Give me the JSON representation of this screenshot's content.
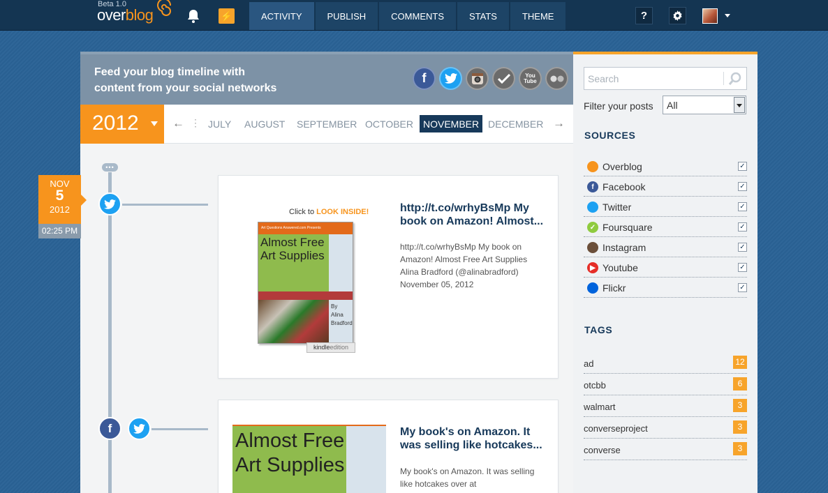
{
  "header": {
    "logo_beta": "Beta 1.0",
    "logo_over": "over",
    "logo_blog": "blog",
    "tabs": [
      {
        "label": "ACTIVITY"
      },
      {
        "label": "PUBLISH"
      },
      {
        "label": "COMMENTS"
      },
      {
        "label": "STATS"
      },
      {
        "label": "THEME"
      }
    ],
    "active_tab": "ACTIVITY",
    "help_label": "?"
  },
  "banner": {
    "line1": "Feed your blog timeline with",
    "line2": "content from your social networks",
    "social_icons": [
      "facebook-icon",
      "twitter-icon",
      "instagram-icon",
      "foursquare-icon",
      "youtube-icon",
      "flickr-icon"
    ],
    "youtube_label": "You Tube"
  },
  "timeline": {
    "year": "2012",
    "months": [
      {
        "label": "JULY"
      },
      {
        "label": "AUGUST"
      },
      {
        "label": "SEPTEMBER"
      },
      {
        "label": "OCTOBER"
      },
      {
        "label": "NOVEMBER"
      },
      {
        "label": "DECEMBER"
      }
    ],
    "active_month": "NOVEMBER",
    "dots": "•••",
    "date": {
      "month": "NOV",
      "day": "5",
      "year": "2012",
      "time": "02:25 PM"
    }
  },
  "posts": [
    {
      "title": "http://t.co/wrhyBsMp My book on Amazon! Almost...",
      "body": "http://t.co/wrhyBsMp My book on Amazon! Almost Free Art Supplies Alina Bradford (@alinabradford) November 05, 2012",
      "sources": [
        "twitter"
      ],
      "cover": {
        "look_prefix": "Click to",
        "look_inside": "LOOK INSIDE!",
        "band": "Art Questions Answered.com Presents",
        "title": "Almost Free Art Supplies",
        "by": "By",
        "author_1": "Alina",
        "author_2": "Bradford",
        "kindle": "kindle",
        "edition": "edition"
      }
    },
    {
      "title": "My book's on Amazon. It was selling like hotcakes...",
      "body": "My book's on Amazon. It was selling like hotcakes over at",
      "sources": [
        "facebook",
        "twitter"
      ],
      "cover": {
        "title": "Almost Free Art Supplies"
      }
    }
  ],
  "sidebar": {
    "search_placeholder": "Search",
    "filter_label": "Filter your posts",
    "filter_value": "All",
    "sources_heading": "SOURCES",
    "sources": [
      {
        "label": "Overblog",
        "checked": true,
        "color": "#f7941d"
      },
      {
        "label": "Facebook",
        "checked": true,
        "color": "#3b5998"
      },
      {
        "label": "Twitter",
        "checked": true,
        "color": "#1da1f2"
      },
      {
        "label": "Foursquare",
        "checked": true,
        "color": "#8fcb3f"
      },
      {
        "label": "Instagram",
        "checked": true,
        "color": "#6b4f3a"
      },
      {
        "label": "Youtube",
        "checked": true,
        "color": "#e52d27"
      },
      {
        "label": "Flickr",
        "checked": true,
        "color": "#0063dc"
      }
    ],
    "tags_heading": "TAGS",
    "tags": [
      {
        "label": "ad",
        "count": "12"
      },
      {
        "label": "otcbb",
        "count": "6"
      },
      {
        "label": "walmart",
        "count": "3"
      },
      {
        "label": "converseproject",
        "count": "3"
      },
      {
        "label": "converse",
        "count": "3"
      }
    ]
  },
  "colors": {
    "accent": "#f7941d",
    "navy": "#17395a",
    "facebook": "#3b5998",
    "twitter": "#1da1f2",
    "background": "#2a6296"
  }
}
